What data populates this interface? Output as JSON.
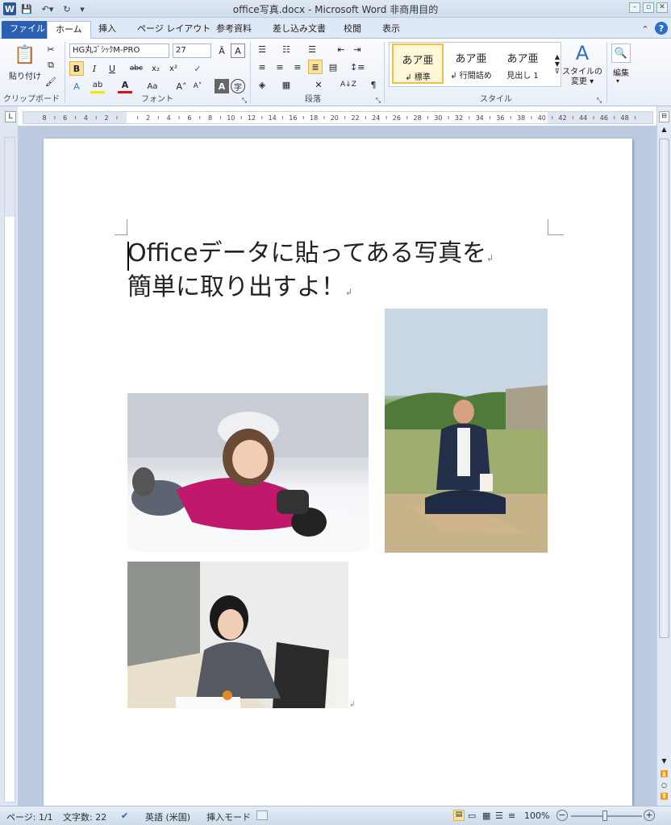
{
  "window": {
    "title": "office写真.docx - Microsoft Word 非商用目的"
  },
  "tabs": {
    "file": "ファイル",
    "home": "ホーム",
    "insert": "挿入",
    "layout": "ページ レイアウト",
    "references": "参考資料",
    "mailings": "差し込み文書",
    "review": "校閲",
    "view": "表示"
  },
  "ribbon": {
    "clipboard": {
      "paste": "貼り付け",
      "label": "クリップボード"
    },
    "font": {
      "name": "HG丸ｺﾞｼｯｸM-PRO",
      "size": "27",
      "label": "フォント"
    },
    "paragraph": {
      "label": "段落"
    },
    "styles": {
      "label": "スタイル",
      "items": [
        {
          "sample": "あア亜",
          "name": "↲ 標準"
        },
        {
          "sample": "あア亜",
          "name": "↲ 行間詰め"
        },
        {
          "sample": "あア亜",
          "name": "見出し 1"
        }
      ],
      "change": "スタイルの\n変更 ▾"
    },
    "editing": {
      "label": "編集"
    }
  },
  "ruler": {
    "h_labels": [
      "8",
      "6",
      "4",
      "2",
      "",
      "2",
      "4",
      "6",
      "8",
      "10",
      "12",
      "14",
      "16",
      "18",
      "20",
      "22",
      "24",
      "26",
      "28",
      "30",
      "32",
      "34",
      "36",
      "38",
      "40",
      "42",
      "44",
      "46",
      "48"
    ]
  },
  "document": {
    "heading_line1": "Officeデータに貼ってある写真を",
    "heading_line2": "簡単に取り出すよ！",
    "para_mark": "↲"
  },
  "status": {
    "page": "ページ: 1/1",
    "chars": "文字数: 22",
    "language": "英語 (米国)",
    "mode": "挿入モード",
    "zoom": "100%"
  },
  "colors": {
    "accent": "#2a5fb1",
    "workspace": "#bccbe0"
  }
}
